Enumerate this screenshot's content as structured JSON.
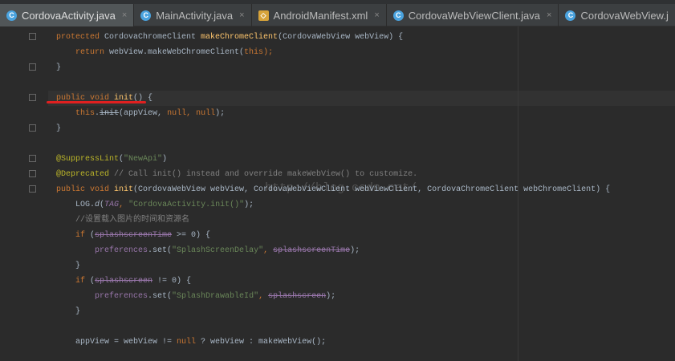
{
  "tabs": [
    {
      "label": "CordovaActivity.java",
      "icon": "class-icon",
      "active": true
    },
    {
      "label": "MainActivity.java",
      "icon": "class-icon"
    },
    {
      "label": "AndroidManifest.xml",
      "icon": "xml-file-icon"
    },
    {
      "label": "CordovaWebViewClient.java",
      "icon": "class-icon"
    },
    {
      "label": "CordovaWebView.j",
      "icon": "class-icon"
    }
  ],
  "watermark": "http://blog.csdn.net/",
  "code": [
    [
      [
        "protected ",
        "kw"
      ],
      [
        "CordovaChromeClient ",
        ""
      ],
      [
        "makeChromeClient",
        "md"
      ],
      [
        "(CordovaWebView webView) {",
        ""
      ]
    ],
    [
      [
        "    return ",
        "kw"
      ],
      [
        "webView.makeWebChromeClient(",
        ""
      ],
      [
        "this",
        "kw"
      ],
      [
        ");",
        "kw"
      ]
    ],
    [
      [
        "}",
        ""
      ]
    ],
    [],
    [
      [
        "public void ",
        "kw"
      ],
      [
        "init",
        "md"
      ],
      [
        "() {",
        ""
      ]
    ],
    [
      [
        "    this",
        "kw"
      ],
      [
        ".",
        ""
      ],
      [
        "init",
        "sk"
      ],
      [
        "(appView, ",
        ""
      ],
      [
        "null, null",
        "kw"
      ],
      [
        ");",
        ""
      ]
    ],
    [
      [
        "}",
        ""
      ]
    ],
    [],
    [
      [
        "@SuppressLint",
        "an"
      ],
      [
        "(",
        ""
      ],
      [
        "\"NewApi\"",
        "st"
      ],
      [
        ")",
        ""
      ]
    ],
    [
      [
        "@Deprecated ",
        "an"
      ],
      [
        "// Call init() instead and override makeWebView() to customize.",
        "cm"
      ]
    ],
    [
      [
        "public void ",
        "kw"
      ],
      [
        "init",
        "md"
      ],
      [
        "(CordovaWebView webView, CordovaWebViewClient webViewClient, CordovaChromeClient webChromeClient) {",
        ""
      ]
    ],
    [
      [
        "    LOG.",
        ""
      ],
      [
        "d",
        "it"
      ],
      [
        "(",
        ""
      ],
      [
        "TAG",
        "fdi"
      ],
      [
        ", ",
        "kw"
      ],
      [
        "\"CordovaActivity.init()\"",
        "st"
      ],
      [
        ");",
        ""
      ]
    ],
    [
      [
        "    //设置载入图片的时间和资源名",
        "cm"
      ]
    ],
    [
      [
        "    if ",
        "kw"
      ],
      [
        "(",
        ""
      ],
      [
        "splashscreenTime",
        "fd sk"
      ],
      [
        " >= 0) {",
        ""
      ]
    ],
    [
      [
        "        preferences",
        "fd"
      ],
      [
        ".set(",
        ""
      ],
      [
        "\"SplashScreenDelay\"",
        "st"
      ],
      [
        ", ",
        "kw"
      ],
      [
        "splashscreenTime",
        "fd sk"
      ],
      [
        ");",
        ""
      ]
    ],
    [
      [
        "    }",
        ""
      ]
    ],
    [
      [
        "    if ",
        "kw"
      ],
      [
        "(",
        ""
      ],
      [
        "splashscreen",
        "fd sk"
      ],
      [
        " != 0) {",
        ""
      ]
    ],
    [
      [
        "        preferences",
        "fd"
      ],
      [
        ".set(",
        ""
      ],
      [
        "\"SplashDrawableId\"",
        "st"
      ],
      [
        ", ",
        "kw"
      ],
      [
        "splashscreen",
        "fd sk"
      ],
      [
        ");",
        ""
      ]
    ],
    [
      [
        "    }",
        ""
      ]
    ],
    [],
    [
      [
        "    appView = webView != ",
        ""
      ],
      [
        "null",
        "kw"
      ],
      [
        " ? webView : makeWebView();",
        ""
      ]
    ]
  ]
}
